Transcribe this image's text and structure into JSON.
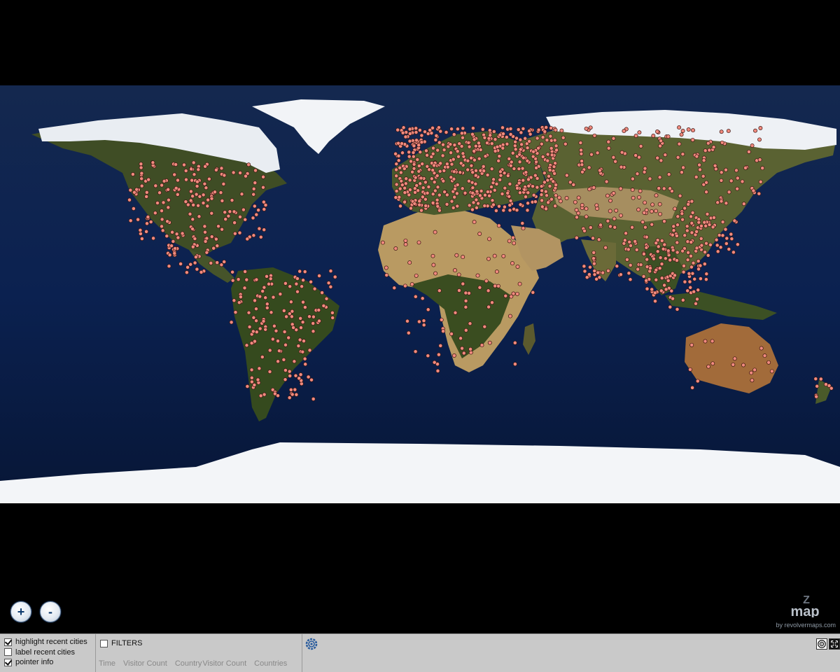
{
  "map": {
    "ocean_color": "#0a1e45",
    "land_color": "#3b4a22",
    "desert_color": "#b99a62",
    "ice_color": "#f3f5f8",
    "marker_color": "#f08a7e"
  },
  "zoom": {
    "in_label": "+",
    "out_label": "-"
  },
  "brand": {
    "logo_text": "map",
    "logo_letter": "Z",
    "byline": "by revolvermaps.com"
  },
  "options": [
    {
      "label": "highlight recent cities",
      "checked": true
    },
    {
      "label": "label recent cities",
      "checked": false
    },
    {
      "label": "pointer info",
      "checked": true
    }
  ],
  "filters": {
    "label": "FILTERS",
    "checked": false,
    "tabs": [
      "Time",
      "Visitor Count",
      "Country",
      "Visitor Count",
      "Countries"
    ]
  },
  "settings": {
    "icon": "gear-icon",
    "right_icons": [
      "target-icon",
      "fullscreen-icon"
    ]
  }
}
